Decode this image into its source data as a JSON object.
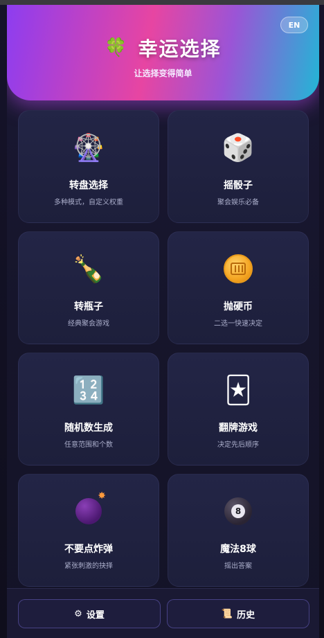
{
  "header": {
    "lang_button": "EN",
    "title_icon": "🍀",
    "title": "幸运选择",
    "subtitle": "让选择变得简单"
  },
  "cards": [
    {
      "icon": "ferris-wheel-icon",
      "glyph": "🎡",
      "title": "转盘选择",
      "desc": "多种模式，自定义权重"
    },
    {
      "icon": "dice-icon",
      "glyph": "🎲",
      "title": "摇骰子",
      "desc": "聚会娱乐必备"
    },
    {
      "icon": "bottle-icon",
      "glyph": "🍾",
      "title": "转瓶子",
      "desc": "经典聚会游戏"
    },
    {
      "icon": "coin-icon",
      "glyph": "",
      "title": "抛硬币",
      "desc": "二选一快速决定"
    },
    {
      "icon": "numbers-icon",
      "glyph": "🔢",
      "title": "随机数生成",
      "desc": "任意范围和个数"
    },
    {
      "icon": "joker-card-icon",
      "glyph": "🃏",
      "title": "翻牌游戏",
      "desc": "决定先后顺序"
    },
    {
      "icon": "bomb-icon",
      "glyph": "",
      "title": "不要点炸弹",
      "desc": "紧张刺激的抉择"
    },
    {
      "icon": "eight-ball-icon",
      "glyph": "",
      "title": "魔法8球",
      "desc": "摇出答案"
    }
  ],
  "bottom": {
    "settings_icon": "⚙",
    "settings_label": "设置",
    "history_icon": "📜",
    "history_label": "历史"
  },
  "colors": {
    "header_gradient": [
      "#8d3df0",
      "#e745a2",
      "#22b6d6"
    ],
    "card_bg": "#232546",
    "app_bg": "#1a1833"
  }
}
